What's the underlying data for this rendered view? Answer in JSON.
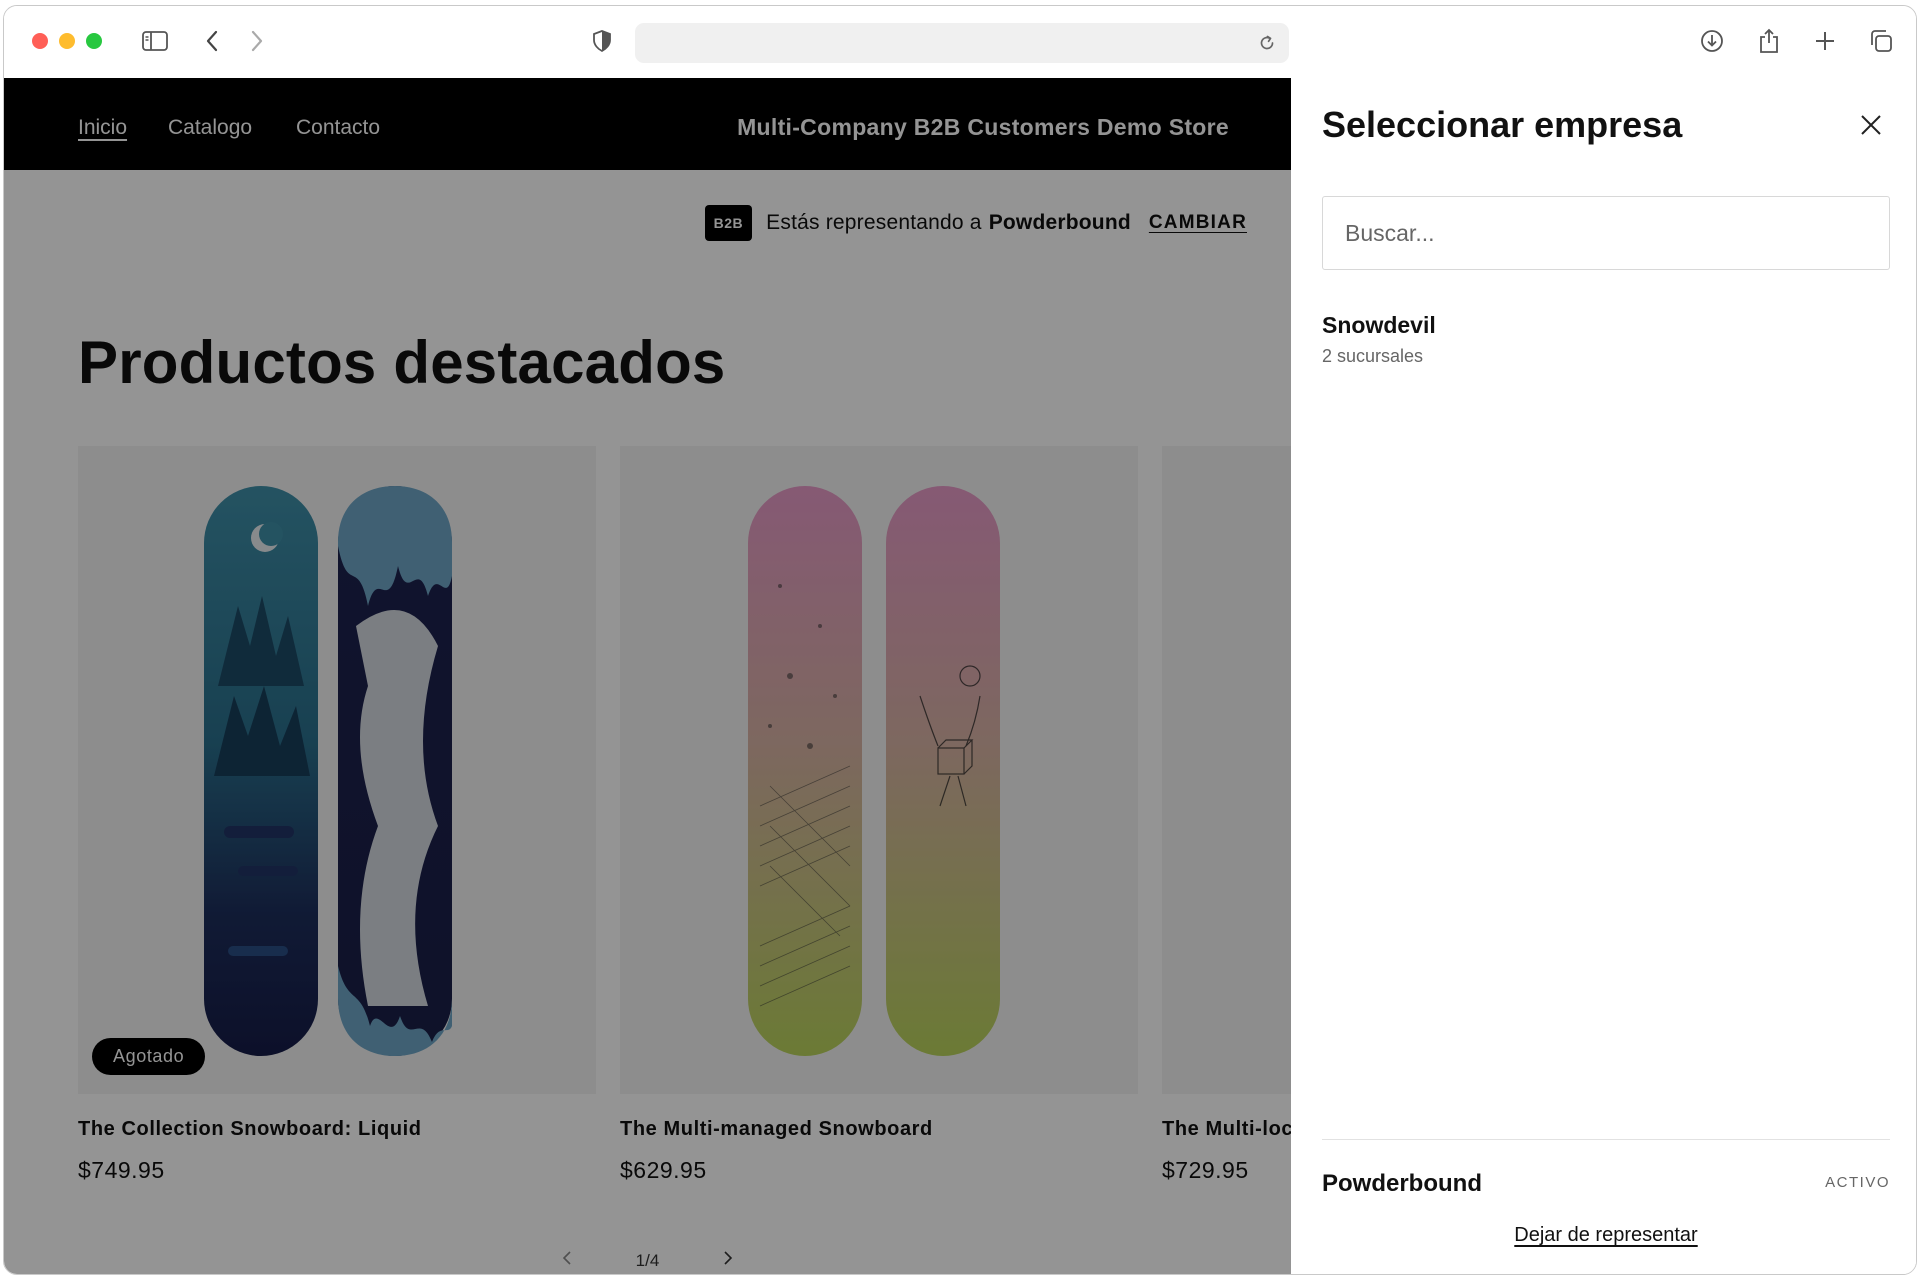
{
  "browser": {
    "url": "",
    "icons": [
      "sidebar-icon",
      "back-icon",
      "forward-icon",
      "shield-icon",
      "reload-icon",
      "download-icon",
      "share-icon",
      "new-tab-icon",
      "tabs-overview-icon"
    ]
  },
  "store": {
    "nav": {
      "home": "Inicio",
      "catalog": "Catalogo",
      "contact": "Contacto"
    },
    "name": "Multi-Company B2B Customers Demo Store",
    "b2b": {
      "badge": "B2B",
      "text": "Estás representando a",
      "company": "Powderbound",
      "change": "CAMBIAR"
    },
    "heading": "Productos destacados",
    "products": [
      {
        "title": "The Collection Snowboard: Liquid",
        "price": "$749.95",
        "badge": "Agotado"
      },
      {
        "title": "The Multi-managed Snowboard",
        "price": "$629.95"
      },
      {
        "title": "The Multi-loc",
        "price": "$729.95"
      }
    ],
    "pager": {
      "label": "1/4"
    }
  },
  "drawer": {
    "title": "Seleccionar empresa",
    "search_placeholder": "Buscar...",
    "companies": [
      {
        "name": "Snowdevil",
        "sub": "2 sucursales"
      }
    ],
    "current": {
      "name": "Powderbound",
      "status": "ACTIVO"
    },
    "stop": "Dejar de representar"
  },
  "colors": {
    "nav_bg": "#000000",
    "overlay": "rgba(0,0,0,0.42)",
    "badge_bg": "#000000",
    "drawer_bg": "#ffffff"
  }
}
